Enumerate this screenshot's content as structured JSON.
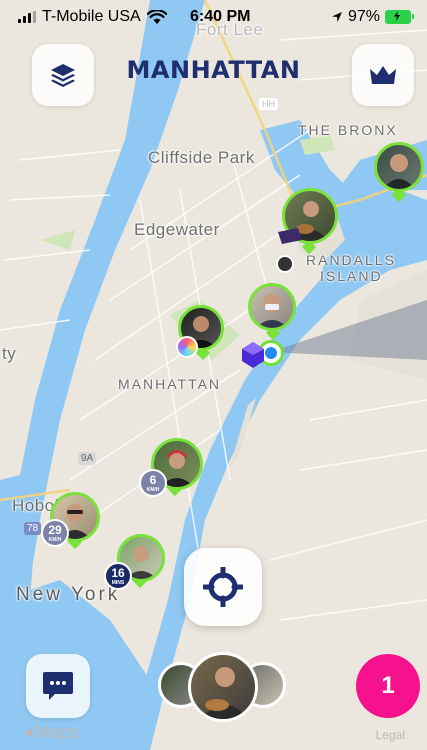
{
  "status_bar": {
    "carrier": "T-Mobile USA",
    "time": "6:40 PM",
    "battery": "97%"
  },
  "header": {
    "title": "MANHATTAN",
    "layers_icon": "layers-icon",
    "crown_icon": "crown-icon",
    "accent_color": "#1f2e6e"
  },
  "map": {
    "labels": {
      "fort_lee": "Fort Lee",
      "bronx": "THE BRONX",
      "cliffside": "Cliffside Park",
      "edgewater": "Edgewater",
      "randalls": "RANDALLS",
      "island": "ISLAND",
      "manhattan": "MANHATTAN",
      "city_partial": "ty",
      "hoboken": "Hoboken",
      "new_york": "New York",
      "route_9a": "9A",
      "route_78": "78",
      "route_hh": "HH"
    }
  },
  "markers": {
    "badge_a": {
      "value": "6",
      "unit": "KM/H"
    },
    "badge_b": {
      "value": "29",
      "unit": "KM/H"
    },
    "badge_c": {
      "value": "16",
      "unit": "MINS"
    },
    "pin_color": "#78e23a"
  },
  "bottom": {
    "chat_icon": "chat-bubble-icon",
    "count": "1",
    "count_color": "#f5128c"
  },
  "footer": {
    "maps_brand": "Maps",
    "legal": "Legal"
  }
}
